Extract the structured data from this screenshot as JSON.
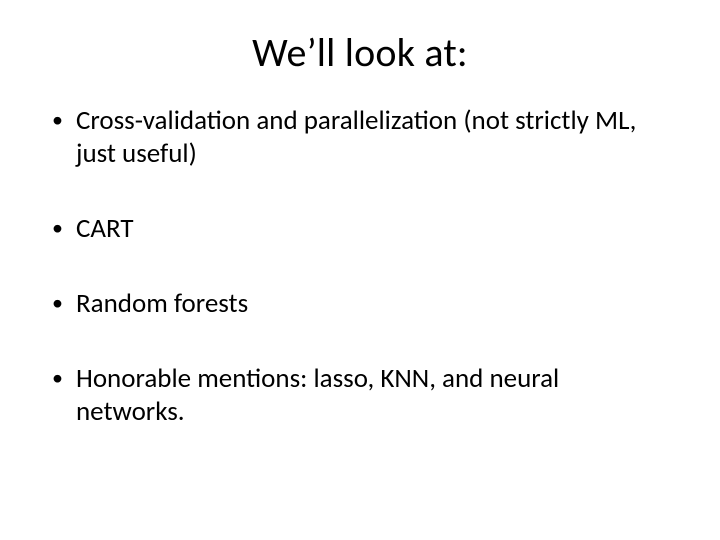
{
  "slide": {
    "title": "We’ll look at:",
    "bullets": [
      "Cross-validation and parallelization (not strictly ML, just useful)",
      "CART",
      "Random forests",
      "Honorable mentions: lasso, KNN, and neural networks."
    ]
  }
}
